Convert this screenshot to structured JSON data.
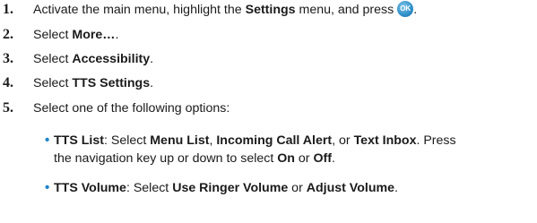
{
  "steps": [
    {
      "num": "1.",
      "pre": "Activate the main menu, highlight the ",
      "bold": "Settings",
      "post": " menu, and press",
      "end": "."
    },
    {
      "num": "2.",
      "pre": "Select ",
      "bold": "More…",
      "post": "."
    },
    {
      "num": "3.",
      "pre": "Select ",
      "bold": "Accessibility",
      "post": "."
    },
    {
      "num": "4.",
      "pre": "Select ",
      "bold": "TTS Settings",
      "post": "."
    },
    {
      "num": "5.",
      "text": "Select one of the following options:"
    }
  ],
  "ok_button": {
    "label": "OK",
    "icon": "ok-key-icon",
    "color": "#2e8fc8"
  },
  "bullet_color": "#1e84c8",
  "options": [
    {
      "title": "TTS List",
      "l1_pre": ": Select ",
      "b1": "Menu List",
      "s1": ", ",
      "b2": "Incoming Call Alert",
      "s2": ", or ",
      "b3": "Text Inbox",
      "s3": ". Press",
      "l2_pre": "the navigation key up or down to select ",
      "b4": "On",
      "s4": " or ",
      "b5": "Off",
      "s5": "."
    },
    {
      "title": "TTS Volume",
      "l1_pre": ": Select ",
      "b1": "Use Ringer Volume",
      "s1": " or ",
      "b2": "Adjust Volume",
      "s2": "."
    }
  ]
}
